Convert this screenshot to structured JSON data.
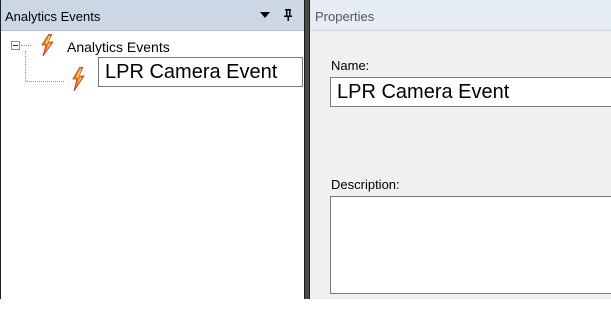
{
  "left_panel": {
    "title": "Analytics Events",
    "dropdown_icon": "caret-down-icon",
    "pin_icon": "pin-icon",
    "tree": {
      "root_label": "Analytics Events",
      "root_icon": "lightning-event-icon",
      "child_edit_value": "LPR Camera Event",
      "child_icon": "lightning-event-icon"
    }
  },
  "properties": {
    "title": "Properties",
    "name_label": "Name:",
    "name_value": "LPR Camera Event",
    "description_label": "Description:",
    "description_value": ""
  },
  "colors": {
    "header_left": "#ccd7e6",
    "header_right": "#e5ecf5",
    "splitter": "#4a4a4a",
    "panel_bg": "#f0f0f0",
    "icon_orange": "#f07a18",
    "icon_red": "#d93c1e"
  }
}
